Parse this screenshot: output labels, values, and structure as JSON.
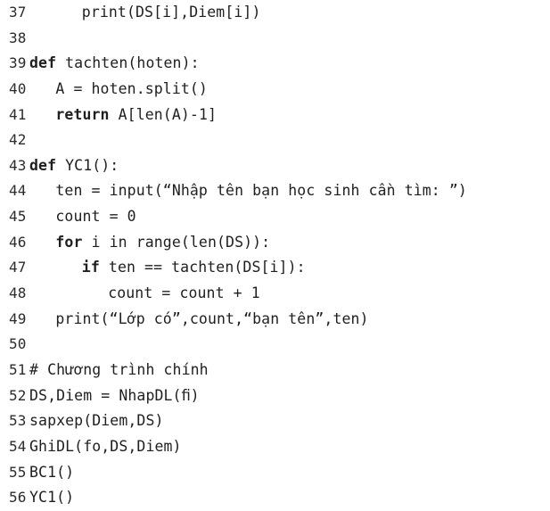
{
  "document": {
    "kind": "python-code-listing",
    "language": "Python",
    "background_color": "#ffffff",
    "text_color": "#1f1f1f",
    "line_number_color": "#2b2b2b",
    "first_line_number": 37,
    "last_line_number": 56
  },
  "lines": [
    {
      "number": "37",
      "indent": 8,
      "code": "print(DS[i],Diem[i])",
      "keyword": ""
    },
    {
      "number": "38",
      "indent": 0,
      "code": "",
      "keyword": ""
    },
    {
      "number": "39",
      "indent": 0,
      "code": "tachten(hoten):",
      "keyword": "def "
    },
    {
      "number": "40",
      "indent": 4,
      "code": "A = hoten.split()",
      "keyword": ""
    },
    {
      "number": "41",
      "indent": 4,
      "code": "A[len(A)-1]",
      "keyword": "return "
    },
    {
      "number": "42",
      "indent": 0,
      "code": "",
      "keyword": ""
    },
    {
      "number": "43",
      "indent": 0,
      "code": "YC1():",
      "keyword": "def "
    },
    {
      "number": "44",
      "indent": 4,
      "code": "ten = input(“Nhập tên bạn học sinh cần tìm: ”)",
      "keyword": ""
    },
    {
      "number": "45",
      "indent": 4,
      "code": "count = 0",
      "keyword": ""
    },
    {
      "number": "46",
      "indent": 4,
      "code": "i in range(len(DS)):",
      "keyword": "for "
    },
    {
      "number": "47",
      "indent": 8,
      "code": "ten == tachten(DS[i]):",
      "keyword": "if "
    },
    {
      "number": "48",
      "indent": 12,
      "code": "count = count + 1",
      "keyword": ""
    },
    {
      "number": "49",
      "indent": 4,
      "code": "print(“Lớp có”,count,“bạn tên”,ten)",
      "keyword": ""
    },
    {
      "number": "50",
      "indent": 0,
      "code": "",
      "keyword": ""
    },
    {
      "number": "51",
      "indent": 0,
      "code": "# Chương trình chính",
      "keyword": ""
    },
    {
      "number": "52",
      "indent": 0,
      "code": "DS,Diem = NhapDL(ﬁ)",
      "keyword": ""
    },
    {
      "number": "53",
      "indent": 0,
      "code": "sapxep(Diem,DS)",
      "keyword": ""
    },
    {
      "number": "54",
      "indent": 0,
      "code": "GhiDL(fo,DS,Diem)",
      "keyword": ""
    },
    {
      "number": "55",
      "indent": 0,
      "code": "BC1()",
      "keyword": ""
    },
    {
      "number": "56",
      "indent": 0,
      "code": "YC1()",
      "keyword": ""
    }
  ]
}
